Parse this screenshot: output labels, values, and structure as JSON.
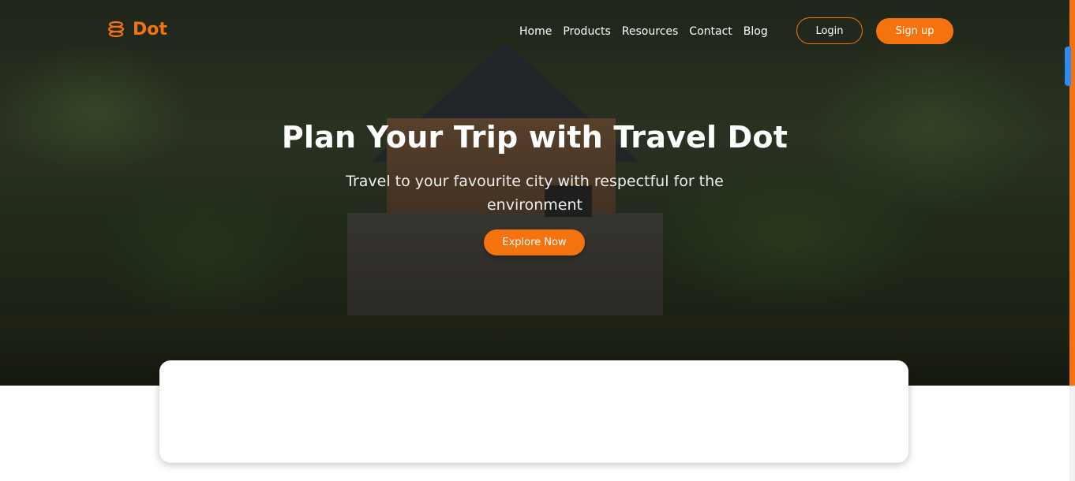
{
  "brand": {
    "name": "Dot",
    "icon": "stacked-disc-logo-icon",
    "color": "#f5730f"
  },
  "nav": {
    "items": [
      "Home",
      "Products",
      "Resources",
      "Contact",
      "Blog"
    ]
  },
  "auth": {
    "login_label": "Login",
    "signup_label": "Sign up"
  },
  "hero": {
    "title": "Plan Your Trip with Travel Dot",
    "subtitle": "Travel to your favourite city with respectful for the environment",
    "cta_label": "Explore Now"
  },
  "colors": {
    "accent": "#f5730f",
    "scroll_indicator": "#2f8cf0"
  }
}
